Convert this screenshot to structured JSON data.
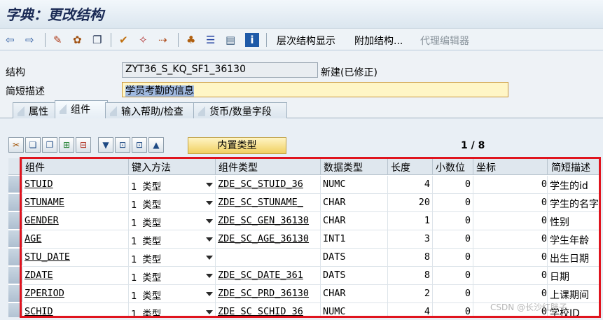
{
  "window": {
    "title": "字典：更改结构"
  },
  "toolbar": {
    "icons": [
      "back-arrow-icon",
      "forward-arrow-icon",
      "display-change-icon",
      "activate-icon",
      "copy-icon",
      "check-icon",
      "where-used-icon",
      "wand-icon",
      "hierarchy-icon",
      "structure-icon",
      "layout-icon",
      "info-icon"
    ],
    "hierarchy_label": "层次结构显示",
    "append_label": "附加结构...",
    "proxy_label": "代理编辑器"
  },
  "form": {
    "structure_label": "结构",
    "structure_value": "ZYT36_S_KQ_SF1_36130",
    "status": "新建(已修正)",
    "desc_label": "简短描述",
    "desc_value": "学员考勤的信息"
  },
  "tabs": [
    {
      "label": "属性",
      "active": false
    },
    {
      "label": "组件",
      "active": true
    },
    {
      "label": "输入帮助/检查",
      "active": false
    },
    {
      "label": "货币/数量字段",
      "active": false
    }
  ],
  "table_toolbar": {
    "icons": [
      "cut-icon",
      "copy-icon",
      "paste-icon",
      "insert-row-icon",
      "delete-row-icon",
      "sort-icon",
      "first-page-icon",
      "last-page-icon",
      "find-icon"
    ],
    "builtin_label": "内置类型",
    "page": "1 / 8"
  },
  "table": {
    "columns": [
      "组件",
      "键入方法",
      "组件类型",
      "数据类型",
      "长度",
      "小数位",
      "坐标",
      "简短描述"
    ],
    "rows": [
      {
        "name": "STUID",
        "method": "1 类型",
        "type": "ZDE_SC_STUID_36",
        "dtype": "NUMC",
        "len": "4",
        "dec": "0",
        "coord": "0",
        "desc": "学生的id"
      },
      {
        "name": "STUNAME",
        "method": "1 类型",
        "type": "ZDE_SC_STUNAME_",
        "dtype": "CHAR",
        "len": "20",
        "dec": "0",
        "coord": "0",
        "desc": "学生的名字"
      },
      {
        "name": "GENDER",
        "method": "1 类型",
        "type": "ZDE_SC_GEN_36130",
        "dtype": "CHAR",
        "len": "1",
        "dec": "0",
        "coord": "0",
        "desc": "性别"
      },
      {
        "name": "AGE",
        "method": "1 类型",
        "type": "ZDE_SC_AGE_36130",
        "dtype": "INT1",
        "len": "3",
        "dec": "0",
        "coord": "0",
        "desc": "学生年龄"
      },
      {
        "name": "STU_DATE",
        "method": "1 类型",
        "type": "",
        "dtype": "DATS",
        "len": "8",
        "dec": "0",
        "coord": "0",
        "desc": "出生日期"
      },
      {
        "name": "ZDATE",
        "method": "1 类型",
        "type": "ZDE_SC_DATE_361",
        "dtype": "DATS",
        "len": "8",
        "dec": "0",
        "coord": "0",
        "desc": "日期"
      },
      {
        "name": "ZPERIOD",
        "method": "1 类型",
        "type": "ZDE_SC_PRD_36130",
        "dtype": "CHAR",
        "len": "2",
        "dec": "0",
        "coord": "0",
        "desc": "上课期间"
      },
      {
        "name": "SCHID",
        "method": "1 类型",
        "type": "ZDE_SC_SCHID_36",
        "dtype": "NUMC",
        "len": "4",
        "dec": "0",
        "coord": "0",
        "desc": "学校ID"
      }
    ]
  },
  "watermark": "CSDN @长沙红胖子"
}
